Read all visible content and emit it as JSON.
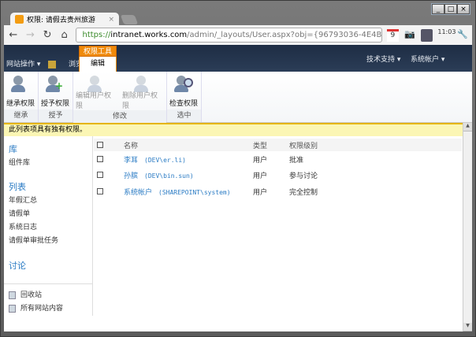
{
  "window": {
    "controls": [
      "_",
      "□",
      "×"
    ]
  },
  "browser": {
    "tab_title": "权限: 请假去贵州旅游",
    "tab_close": "×",
    "url_scheme": "https://",
    "url_host": "intranet.works.com",
    "url_path": "/admin/_layouts/User.aspx?obj={96793036-4E4B-",
    "calendar_day": "9",
    "clock": "11:03"
  },
  "sp_nav": {
    "site_actions": "网站操作 ▾",
    "browse": "浏览",
    "ribbon_context": "权限工具",
    "ribbon_tab": "编辑",
    "help": "技术支持 ▾",
    "user": "系统帐户 ▾"
  },
  "ribbon": {
    "groups": [
      {
        "label": "继承",
        "buttons": [
          {
            "label": "继承权限",
            "enabled": true
          }
        ]
      },
      {
        "label": "授予",
        "buttons": [
          {
            "label": "授予权限",
            "enabled": true
          }
        ]
      },
      {
        "label": "修改",
        "buttons": [
          {
            "label": "编辑用户权限",
            "enabled": false
          },
          {
            "label": "删除用户权限",
            "enabled": false
          }
        ]
      },
      {
        "label": "选中",
        "buttons": [
          {
            "label": "检查权限",
            "enabled": true
          }
        ]
      }
    ]
  },
  "status": "此列表项具有独有权限。",
  "quicklaunch": {
    "libraries_heading": "库",
    "libraries": [
      "组件库"
    ],
    "lists_heading": "列表",
    "lists": [
      "年假汇总",
      "请假单",
      "系统日志",
      "请假单审批任务"
    ],
    "discussions_heading": "讨论",
    "recycle": "回收站",
    "all_content": "所有网站内容"
  },
  "table": {
    "headers": [
      "名称",
      "类型",
      "权限级别"
    ],
    "rows": [
      {
        "name": "李耳",
        "account": "(DEV\\er.li)",
        "type": "用户",
        "level": "批准"
      },
      {
        "name": "孙膑",
        "account": "(DEV\\bin.sun)",
        "type": "用户",
        "level": "参与讨论"
      },
      {
        "name": "系统帐户",
        "account": "(SHAREPOINT\\system)",
        "type": "用户",
        "level": "完全控制"
      }
    ]
  }
}
